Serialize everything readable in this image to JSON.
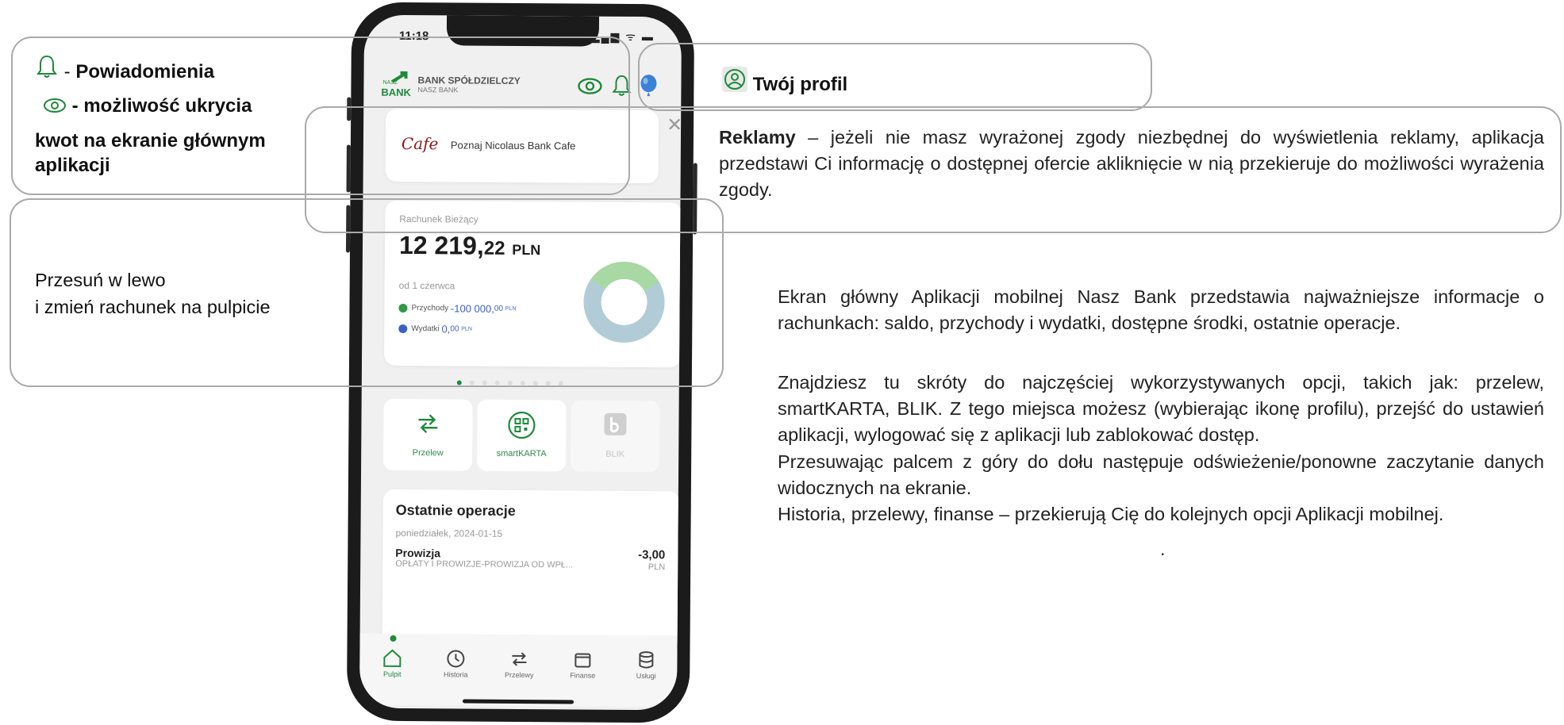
{
  "callouts": {
    "bell_label": "Powiadomienia",
    "bell_dash": "-",
    "eye_label": " - możliwość ukrycia",
    "eye_label_2": "kwot na ekranie głównym",
    "eye_label_3": "aplikacji",
    "swipe_line1": "Przesuń w lewo",
    "swipe_line2": "i zmień rachunek na pulpicie",
    "profile_label": "Twój profil",
    "ads_bold": "Reklamy",
    "ads_text": " – jeżeli nie masz wyrażonej zgody niezbędnej do wyświetlenia reklamy, aplikacja przedstawi Ci informację o dostępnej ofercie akliknięcie w nią przekieruje do możliwości wyrażenia zgody.",
    "para1": "Ekran główny Aplikacji mobilnej Nasz Bank przedstawia najważniejsze informacje o rachunkach: saldo, przychody i wydatki, dostępne środki, ostatnie operacje.",
    "para2": "Znajdziesz tu skróty do najczęściej wykorzystywanych opcji, takich jak: przelew, smartKARTA, BLIK. Z tego miejsca możesz (wybierając ikonę profilu), przejść do ustawień aplikacji, wylogować się z aplikacji lub zablokować dostęp.",
    "para3": "Przesuwając palcem z góry do dołu następuje odświeżenie/ponowne zaczytanie danych widocznych na ekranie.",
    "para4": "Historia, przelewy, finanse – przekierują Cię do kolejnych opcji Aplikacji mobilnej.",
    "trailing_dot": "."
  },
  "phone": {
    "time": "11:18",
    "status_icons": "▂▄▆ ᯤ ▬",
    "bank_name_1": "BANK SPÓŁDZIELCZY",
    "bank_name_2": "NASZ BANK",
    "logo_small_1": "NASZ",
    "logo_small_2": "BANK",
    "ad_cafe": "Cafe",
    "ad_text": "Poznaj Nicolaus Bank Cafe",
    "ad_close": "✕",
    "account_label": "Rachunek Bieżący",
    "balance_main": "12 219,",
    "balance_frac": "22",
    "balance_currency": "PLN",
    "from_label": "od 1 czerwca",
    "income_label": "Przychody",
    "income_main": "-100 000,",
    "income_frac": "00",
    "income_cur": "PLN",
    "expense_label": "Wydatki",
    "expense_main": "0,",
    "expense_frac": "00",
    "expense_cur": "PLN",
    "pager_count": 9,
    "pager_active": 0,
    "shortcuts": [
      {
        "label": "Przelew",
        "icon": "transfer-icon"
      },
      {
        "label": "smartKARTA",
        "icon": "qr-icon"
      },
      {
        "label": "BLIK",
        "icon": "blik-icon"
      }
    ],
    "ops_title": "Ostatnie operacje",
    "ops_date": "poniedziałek, 2024-01-15",
    "ops_name": "Prowizja",
    "ops_desc": "OPŁATY I PROWIZJE-PROWIZJA OD WPŁ...",
    "ops_amount": "-3,00",
    "ops_currency": "PLN",
    "tabs": [
      {
        "label": "Pulpit",
        "icon": "home-icon",
        "active": true
      },
      {
        "label": "Historia",
        "icon": "history-icon",
        "active": false
      },
      {
        "label": "Przelewy",
        "icon": "transfer-icon",
        "active": false
      },
      {
        "label": "Finanse",
        "icon": "finance-icon",
        "active": false
      },
      {
        "label": "Usługi",
        "icon": "services-icon",
        "active": false
      }
    ]
  },
  "colors": {
    "brand_green": "#1e8a3a",
    "donut_green": "#a8d8a3",
    "donut_blue": "#b7c7ec",
    "callout_border": "#a9a9a9"
  }
}
